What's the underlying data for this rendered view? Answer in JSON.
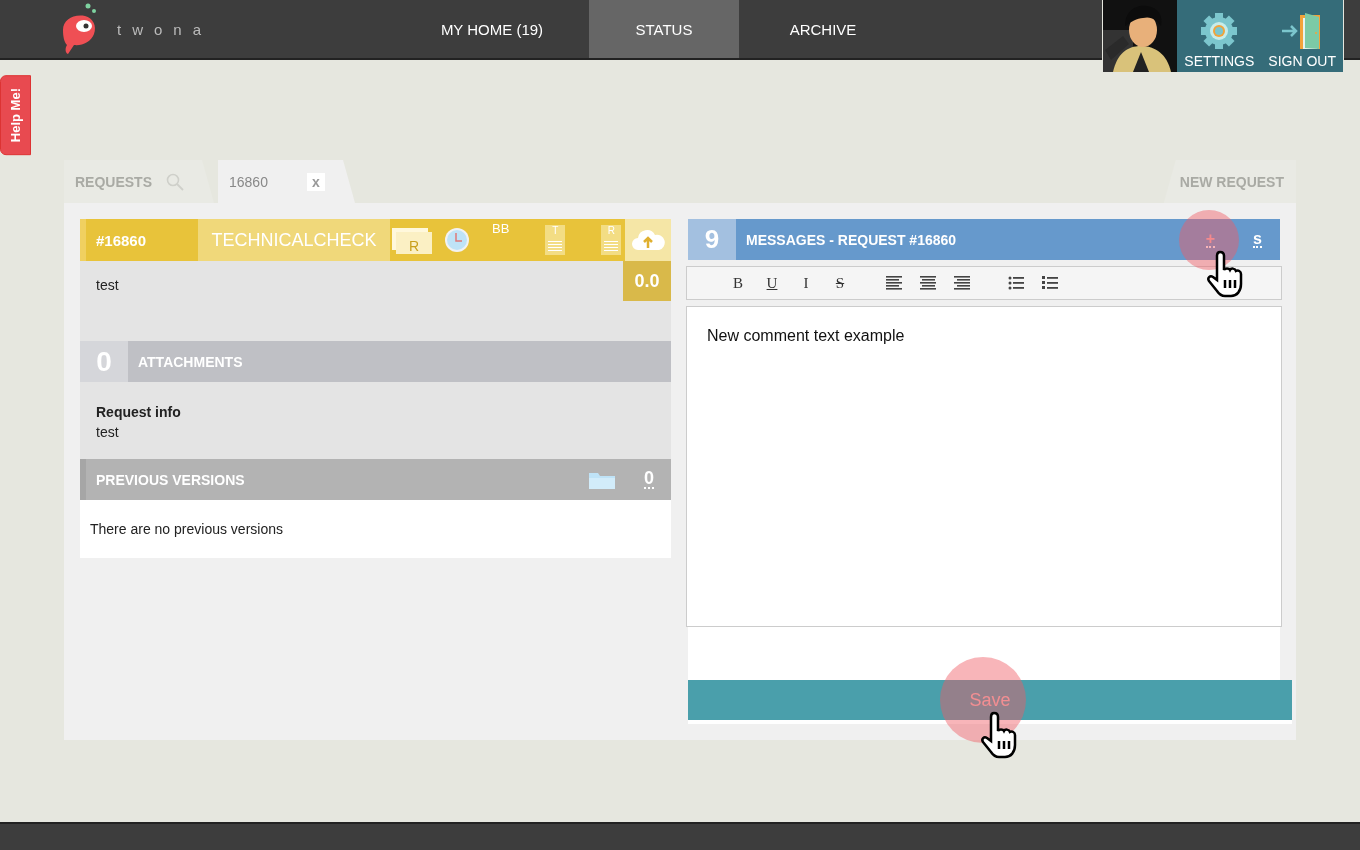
{
  "header": {
    "logo": "twona",
    "nav": [
      {
        "label": "MY HOME (19)",
        "selected": false
      },
      {
        "label": "STATUS",
        "selected": true
      },
      {
        "label": "ARCHIVE",
        "selected": false
      }
    ],
    "user_menu": [
      {
        "label": "SETTINGS",
        "kind": "settings"
      },
      {
        "label": "SIGN OUT",
        "kind": "signout"
      }
    ]
  },
  "help_tab": "Help Me!",
  "tabs": [
    {
      "label": "REQUESTS",
      "kind": "search",
      "selected": false
    },
    {
      "label": "16860",
      "kind": "closable",
      "close": "x",
      "selected": true
    }
  ],
  "new_request": "NEW REQUEST",
  "request": {
    "id": "#16860",
    "status": "TECHNICALCHECK",
    "box_label": "R",
    "user": "BB",
    "doc_labels": [
      "T",
      "R"
    ],
    "score": "0.0",
    "description": "test"
  },
  "attachments": {
    "count": "0",
    "title": "ATTACHMENTS"
  },
  "info": {
    "label": "Request info",
    "value": "test"
  },
  "versions": {
    "title": "PREVIOUS VERSIONS",
    "count": "0",
    "empty": "There are no previous versions"
  },
  "messages": {
    "count": "9",
    "title": "MESSAGES - REQUEST #16860",
    "add": "+",
    "sort": "s"
  },
  "toolbar": [
    {
      "kind": "bold",
      "label": "B"
    },
    {
      "kind": "underline",
      "label": "U"
    },
    {
      "kind": "italic",
      "label": "I"
    },
    {
      "kind": "strike",
      "label": "S"
    },
    {
      "kind": "align-left"
    },
    {
      "kind": "align-center"
    },
    {
      "kind": "align-right"
    },
    {
      "kind": "bullet-list"
    },
    {
      "kind": "numbered-list"
    }
  ],
  "editor": {
    "value": "New comment text example"
  },
  "save": "Save"
}
